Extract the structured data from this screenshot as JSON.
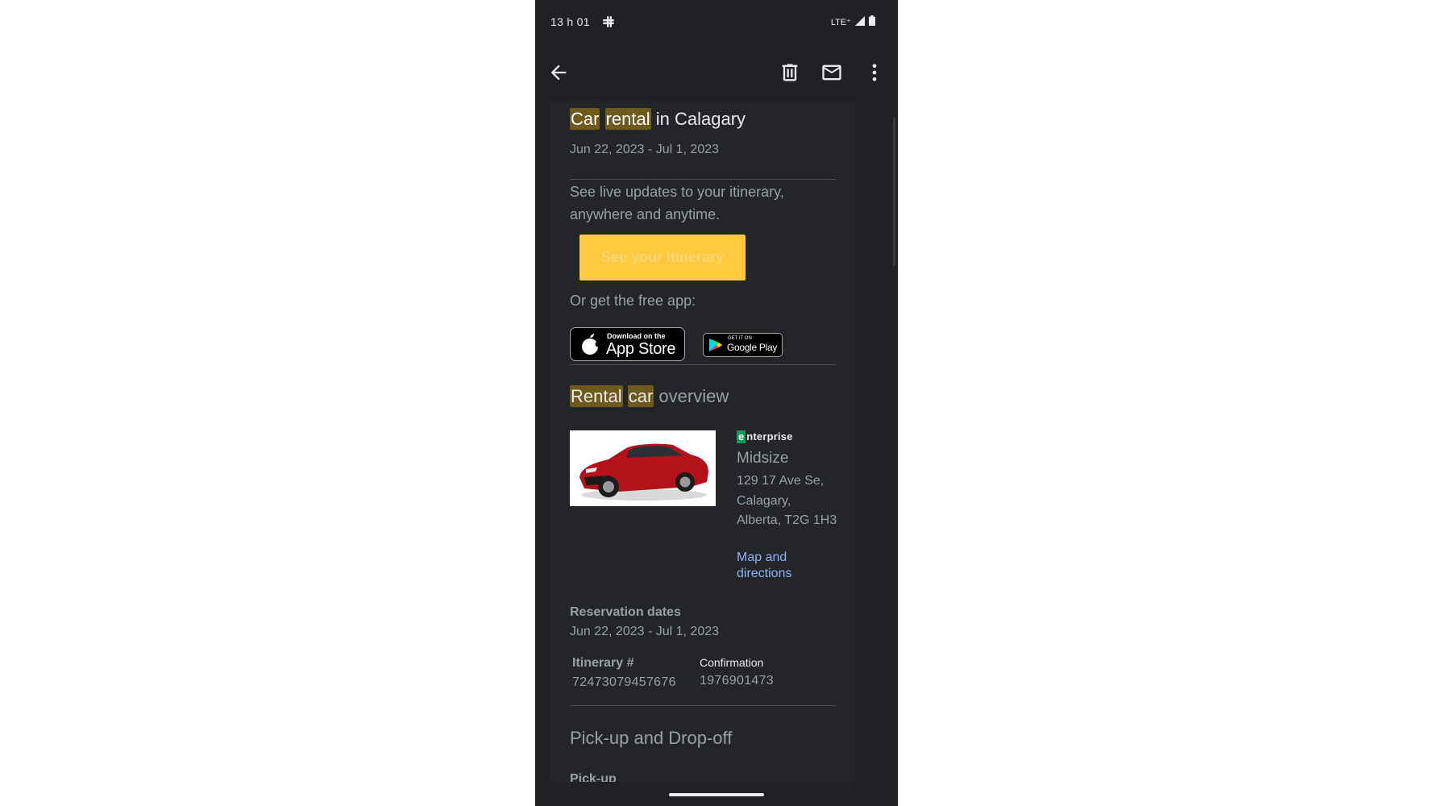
{
  "status_bar": {
    "time": "13 h 01",
    "network": "LTE⁺"
  },
  "toolbar": {
    "icons": [
      "back-arrow-icon",
      "trash-icon",
      "mail-icon",
      "more-vert-icon"
    ]
  },
  "email": {
    "title": {
      "highlight_1": "Car",
      "highlight_2": "rental",
      "rest": "in Calagary"
    },
    "trip_dates": "Jun 22, 2023 - Jul 1, 2023",
    "live_updates_text": "See live updates to your itinerary, anywhere and anytime.",
    "itinerary_button": "See your itinerary",
    "free_app_text": "Or get the free app:",
    "app_store_badge": {
      "small": "Download on the",
      "big": "App Store"
    },
    "google_play_badge": {
      "small": "GET IT ON",
      "big": "Google Play"
    },
    "overview_title": {
      "highlight_1": "Rental",
      "highlight_2": "car",
      "rest": "overview"
    },
    "rental": {
      "company_logo_initial": "e",
      "company_logo_rest": "nterprise",
      "car_class": "Midsize",
      "address": "129 17 Ave Se, Calagary, Alberta, T2G 1H3",
      "map_link": "Map and directions"
    },
    "reservation": {
      "label": "Reservation dates",
      "dates": "Jun 22, 2023 - Jul 1, 2023"
    },
    "itinerary": {
      "label": "Itinerary #",
      "value": "72473079457676"
    },
    "confirmation": {
      "label": "Confirmation",
      "value": "1976901473"
    },
    "pickup_dropoff_title": "Pick-up and Drop-off",
    "pickup_label": "Pick-up"
  },
  "colors": {
    "background": "#202124",
    "content_bg": "#242529",
    "highlight": "#6f5a1d",
    "button": "#ffc940",
    "link": "#8ab4f8",
    "enterprise_green": "#169a5a"
  }
}
